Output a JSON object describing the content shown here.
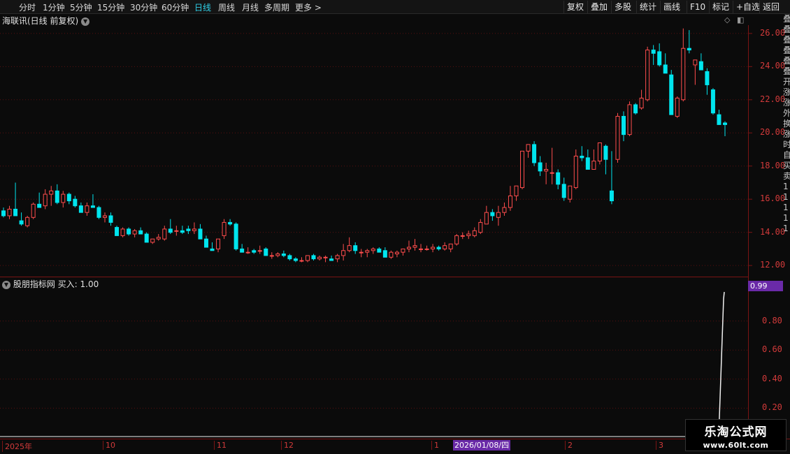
{
  "toolbar": {
    "periods": [
      {
        "label": "分时",
        "active": false
      },
      {
        "label": "1分钟",
        "active": false
      },
      {
        "label": "5分钟",
        "active": false
      },
      {
        "label": "15分钟",
        "active": false
      },
      {
        "label": "30分钟",
        "active": false
      },
      {
        "label": "60分钟",
        "active": false
      },
      {
        "label": "日线",
        "active": true
      },
      {
        "label": "周线",
        "active": false
      },
      {
        "label": "月线",
        "active": false
      },
      {
        "label": "多周期",
        "active": false
      },
      {
        "label": "更多 >",
        "active": false
      }
    ],
    "actions": [
      "复权",
      "叠加",
      "多股",
      "统计",
      "画线",
      "F10",
      "标记",
      "+自选",
      "返回"
    ]
  },
  "chart": {
    "title": "海联讯(日线 前复权)",
    "price_ticks": [
      "26.00",
      "24.00",
      "22.00",
      "20.00",
      "18.00",
      "16.00",
      "14.00",
      "12.00"
    ]
  },
  "indicator": {
    "title": "股朋指标网 买入: 1.00",
    "ticks": [
      "0.80",
      "0.60",
      "0.40",
      "0.20"
    ],
    "current_value": "0.99"
  },
  "date_axis": {
    "ticks": [
      "2025年",
      "10",
      "11",
      "12",
      "1",
      "2",
      "3"
    ],
    "cursor_label": "2026/01/08/四"
  },
  "right_strip_text": [
    "叠",
    "叠",
    "叠",
    "叠",
    "叠",
    "叠",
    "开",
    "涨",
    "涨",
    "外",
    "换",
    "涨",
    "时",
    "自",
    "买",
    "卖",
    "1",
    "1",
    "1",
    "1",
    "1"
  ],
  "watermark": {
    "line1": "乐淘公式网",
    "line2": "www.60lt.com"
  },
  "colors": {
    "up": "#ff4d4d",
    "down": "#00e5ee",
    "background": "#0b0b0b",
    "grid": "#5a1010",
    "accent": "#6a2aa8"
  },
  "chart_data": {
    "type": "candlestick",
    "title": "海联讯(日线 前复权)",
    "ylim": [
      11.5,
      26.5
    ],
    "candles": [
      [
        15.3,
        15.5,
        14.9,
        15.0
      ],
      [
        15.0,
        15.6,
        14.8,
        15.4
      ],
      [
        15.4,
        17.0,
        15.2,
        15.0
      ],
      [
        14.7,
        15.2,
        14.4,
        14.5
      ],
      [
        14.4,
        15.0,
        14.3,
        14.9
      ],
      [
        14.9,
        15.8,
        14.8,
        15.7
      ],
      [
        15.7,
        16.4,
        15.5,
        15.5
      ],
      [
        15.6,
        16.6,
        15.4,
        16.3
      ],
      [
        16.3,
        16.8,
        15.6,
        16.5
      ],
      [
        16.5,
        16.9,
        15.7,
        15.8
      ],
      [
        15.8,
        16.5,
        15.5,
        16.3
      ],
      [
        16.3,
        16.4,
        15.7,
        15.9
      ],
      [
        16.0,
        16.2,
        15.5,
        15.6
      ],
      [
        15.6,
        15.8,
        15.3,
        15.2
      ],
      [
        15.2,
        15.8,
        15.0,
        15.6
      ],
      [
        15.6,
        16.3,
        15.5,
        15.5
      ],
      [
        15.5,
        15.6,
        14.8,
        14.9
      ],
      [
        14.9,
        15.2,
        14.6,
        15.0
      ],
      [
        15.0,
        15.2,
        14.4,
        14.6
      ],
      [
        14.3,
        14.4,
        13.9,
        13.8
      ],
      [
        13.8,
        14.3,
        13.7,
        14.2
      ],
      [
        14.2,
        14.3,
        13.8,
        13.9
      ],
      [
        13.9,
        14.2,
        13.7,
        14.1
      ],
      [
        14.1,
        14.3,
        13.9,
        13.9
      ],
      [
        13.9,
        14.0,
        13.4,
        13.4
      ],
      [
        13.4,
        13.6,
        13.3,
        13.6
      ],
      [
        13.6,
        13.9,
        13.5,
        13.7
      ],
      [
        13.6,
        14.4,
        13.5,
        14.2
      ],
      [
        14.2,
        14.8,
        13.9,
        14.0
      ],
      [
        14.1,
        14.4,
        13.8,
        14.1
      ],
      [
        14.1,
        14.4,
        13.9,
        14.0
      ],
      [
        14.2,
        14.4,
        13.9,
        14.1
      ],
      [
        14.1,
        14.6,
        13.9,
        14.2
      ],
      [
        14.2,
        14.5,
        13.7,
        13.6
      ],
      [
        13.6,
        13.8,
        13.1,
        13.1
      ],
      [
        13.0,
        13.4,
        12.9,
        12.9
      ],
      [
        13.0,
        13.5,
        12.8,
        13.6
      ],
      [
        13.8,
        14.8,
        13.6,
        14.6
      ],
      [
        14.6,
        14.8,
        14.4,
        14.5
      ],
      [
        14.5,
        14.6,
        12.9,
        13.0
      ],
      [
        13.0,
        13.3,
        12.8,
        12.8
      ],
      [
        12.8,
        13.1,
        12.7,
        12.8
      ],
      [
        12.9,
        13.0,
        12.7,
        12.8
      ],
      [
        12.9,
        13.2,
        12.7,
        12.9
      ],
      [
        13.0,
        13.1,
        12.6,
        12.6
      ],
      [
        12.6,
        12.8,
        12.4,
        12.6
      ],
      [
        12.6,
        12.8,
        12.5,
        12.7
      ],
      [
        12.7,
        12.9,
        12.5,
        12.6
      ],
      [
        12.6,
        12.7,
        12.3,
        12.4
      ],
      [
        12.4,
        12.5,
        12.2,
        12.3
      ],
      [
        12.3,
        12.5,
        12.2,
        12.3
      ],
      [
        12.3,
        12.6,
        12.2,
        12.6
      ],
      [
        12.6,
        12.7,
        12.3,
        12.4
      ],
      [
        12.4,
        12.6,
        12.3,
        12.5
      ],
      [
        12.5,
        12.6,
        12.2,
        12.5
      ],
      [
        12.4,
        12.6,
        12.3,
        12.3
      ],
      [
        12.4,
        12.7,
        12.2,
        12.6
      ],
      [
        12.6,
        13.3,
        12.3,
        12.9
      ],
      [
        12.9,
        13.7,
        12.8,
        13.2
      ],
      [
        13.2,
        13.4,
        12.7,
        12.9
      ],
      [
        12.8,
        13.0,
        12.5,
        12.8
      ],
      [
        12.8,
        13.0,
        12.5,
        12.9
      ],
      [
        12.9,
        13.1,
        12.7,
        13.0
      ],
      [
        13.0,
        13.1,
        12.8,
        12.8
      ],
      [
        12.9,
        13.1,
        12.5,
        12.5
      ],
      [
        12.5,
        12.9,
        12.4,
        12.8
      ],
      [
        12.7,
        12.9,
        12.5,
        12.8
      ],
      [
        12.8,
        13.0,
        12.6,
        13.0
      ],
      [
        13.0,
        13.5,
        12.8,
        13.1
      ],
      [
        13.1,
        13.6,
        12.9,
        13.2
      ],
      [
        13.0,
        13.3,
        12.8,
        13.0
      ],
      [
        13.0,
        13.2,
        12.9,
        13.0
      ],
      [
        13.0,
        13.3,
        12.8,
        13.1
      ],
      [
        13.1,
        13.2,
        12.9,
        13.0
      ],
      [
        13.0,
        13.4,
        12.9,
        13.2
      ],
      [
        13.0,
        13.3,
        12.8,
        13.3
      ],
      [
        13.3,
        13.9,
        13.2,
        13.8
      ],
      [
        13.8,
        14.0,
        13.6,
        13.8
      ],
      [
        13.8,
        14.1,
        13.6,
        13.9
      ],
      [
        13.8,
        14.3,
        13.7,
        14.1
      ],
      [
        14.0,
        14.8,
        13.9,
        14.6
      ],
      [
        14.5,
        15.6,
        14.5,
        15.2
      ],
      [
        15.2,
        15.4,
        14.7,
        15.0
      ],
      [
        14.9,
        15.6,
        14.4,
        15.2
      ],
      [
        15.2,
        15.8,
        15.0,
        15.5
      ],
      [
        15.5,
        16.8,
        15.3,
        16.2
      ],
      [
        16.2,
        16.7,
        15.9,
        16.8
      ],
      [
        16.7,
        18.8,
        16.6,
        18.9
      ],
      [
        18.9,
        19.3,
        18.5,
        19.3
      ],
      [
        19.3,
        19.5,
        18.0,
        18.2
      ],
      [
        18.2,
        18.6,
        17.4,
        17.7
      ],
      [
        17.7,
        18.2,
        16.9,
        17.8
      ],
      [
        17.6,
        19.1,
        16.9,
        17.6
      ],
      [
        17.6,
        17.8,
        16.6,
        16.9
      ],
      [
        16.9,
        17.3,
        15.9,
        16.1
      ],
      [
        16.0,
        16.4,
        15.8,
        16.8
      ],
      [
        16.7,
        19.0,
        16.6,
        18.6
      ],
      [
        18.6,
        19.2,
        18.3,
        18.5
      ],
      [
        18.5,
        19.0,
        17.9,
        17.8
      ],
      [
        17.8,
        19.0,
        17.8,
        18.3
      ],
      [
        18.3,
        19.4,
        18.1,
        19.4
      ],
      [
        19.2,
        19.3,
        17.5,
        18.4
      ],
      [
        16.5,
        18.9,
        15.7,
        15.9
      ],
      [
        18.4,
        21.2,
        18.2,
        21.0
      ],
      [
        21.0,
        21.3,
        19.5,
        19.9
      ],
      [
        19.9,
        21.9,
        19.8,
        21.7
      ],
      [
        21.7,
        21.8,
        21.1,
        21.2
      ],
      [
        21.5,
        22.6,
        21.4,
        22.1
      ],
      [
        22.0,
        25.2,
        21.9,
        25.0
      ],
      [
        25.0,
        25.3,
        24.1,
        24.8
      ],
      [
        24.9,
        25.4,
        24.0,
        24.1
      ],
      [
        24.1,
        24.8,
        23.6,
        23.6
      ],
      [
        23.5,
        23.8,
        21.2,
        21.1
      ],
      [
        21.0,
        22.2,
        20.9,
        22.1
      ],
      [
        22.0,
        26.3,
        21.9,
        25.1
      ],
      [
        25.1,
        26.2,
        24.8,
        25.0
      ],
      [
        24.1,
        24.3,
        22.9,
        24.4
      ],
      [
        24.3,
        24.8,
        23.8,
        23.8
      ],
      [
        23.7,
        23.9,
        22.3,
        22.9
      ],
      [
        22.6,
        22.7,
        21.1,
        21.2
      ],
      [
        21.1,
        21.4,
        20.5,
        20.5
      ],
      [
        20.6,
        20.7,
        19.8,
        20.5
      ]
    ]
  }
}
